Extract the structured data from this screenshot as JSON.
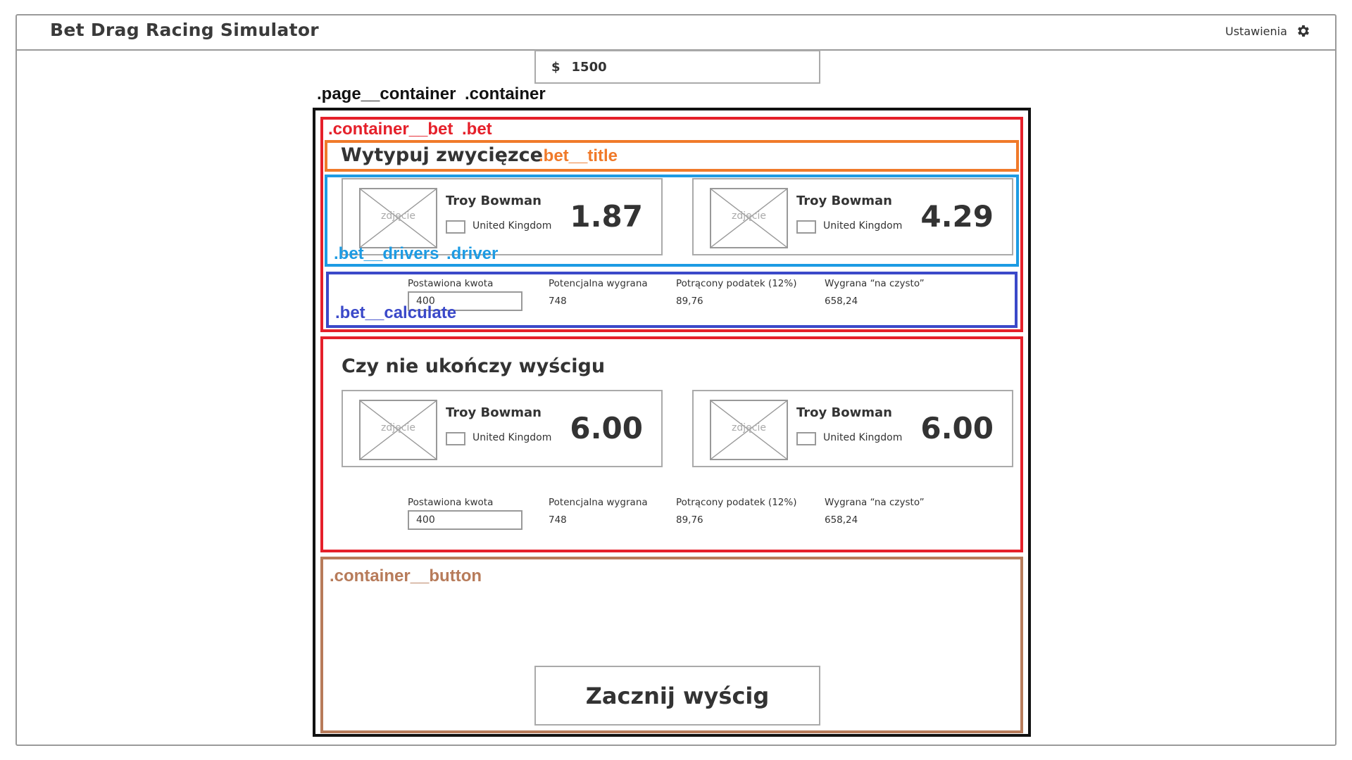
{
  "header": {
    "app_title": "Bet Drag Racing Simulator",
    "settings_label": "Ustawienia",
    "settings_icon": "gear-icon"
  },
  "balance": {
    "currency": "$",
    "amount": "1500"
  },
  "annotations": {
    "page_container": ".page__container",
    "container": ".container",
    "container_bet": ".container__bet",
    "bet": ".bet",
    "bet_title": ".bet__title",
    "bet_drivers": ".bet__drivers",
    "driver": ".driver",
    "bet_calculate": ".bet__calculate",
    "container_button": ".container__button"
  },
  "bets": [
    {
      "title": "Wytypuj zwycięzce",
      "drivers": [
        {
          "photo_label": "zdjęcie",
          "name": "Troy Bowman",
          "country": "United Kingdom",
          "odds": "1.87"
        },
        {
          "photo_label": "zdjęcie",
          "name": "Troy Bowman",
          "country": "United Kingdom",
          "odds": "4.29"
        }
      ],
      "calculate": {
        "stake_label": "Postawiona kwota",
        "stake_value": "400",
        "potential_label": "Potencjalna wygrana",
        "potential_value": "748",
        "tax_label": "Potrącony podatek (12%)",
        "tax_value": "89,76",
        "net_label": "Wygrana “na czysto”",
        "net_value": "658,24"
      }
    },
    {
      "title": "Czy nie ukończy wyścigu",
      "drivers": [
        {
          "photo_label": "zdjęcie",
          "name": "Troy Bowman",
          "country": "United Kingdom",
          "odds": "6.00"
        },
        {
          "photo_label": "zdjęcie",
          "name": "Troy Bowman",
          "country": "United Kingdom",
          "odds": "6.00"
        }
      ],
      "calculate": {
        "stake_label": "Postawiona kwota",
        "stake_value": "400",
        "potential_label": "Potencjalna wygrana",
        "potential_value": "748",
        "tax_label": "Potrącony podatek (12%)",
        "tax_value": "89,76",
        "net_label": "Wygrana “na czysto”",
        "net_value": "658,24"
      }
    }
  ],
  "start_button_label": "Zacznij wyścig",
  "colors": {
    "annotation_black": "#111111",
    "annotation_red": "#e5202a",
    "annotation_orange": "#f07a2a",
    "annotation_cyan": "#1d9be3",
    "annotation_blue": "#3b49c9",
    "annotation_brown": "#b77b5a"
  }
}
